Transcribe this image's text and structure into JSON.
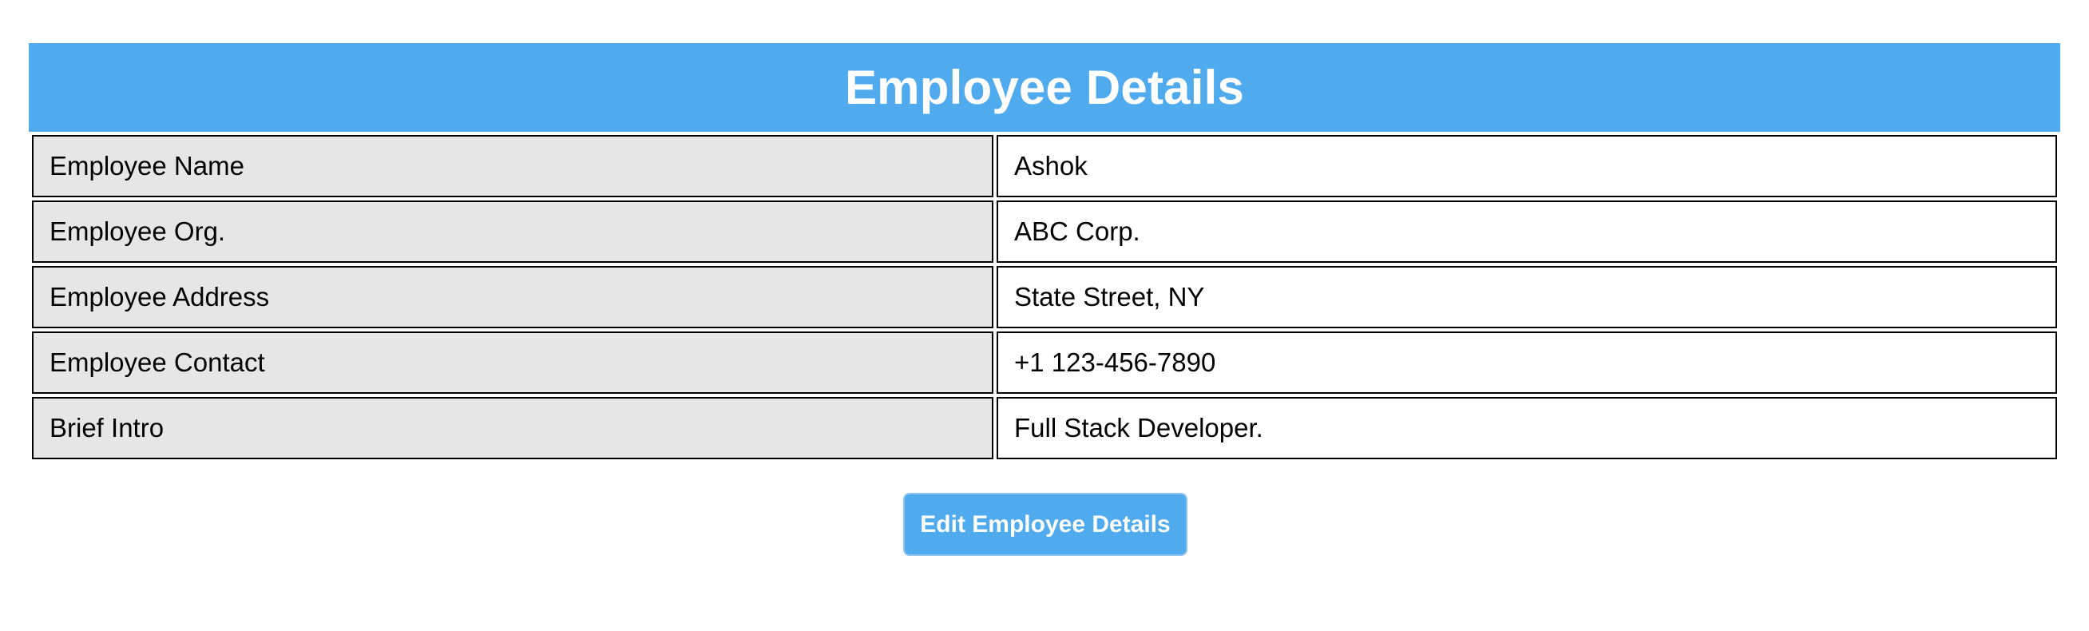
{
  "header": {
    "title": "Employee Details"
  },
  "details": {
    "rows": [
      {
        "label": "Employee Name",
        "value": "Ashok"
      },
      {
        "label": "Employee Org.",
        "value": "ABC Corp."
      },
      {
        "label": "Employee Address",
        "value": "State Street, NY"
      },
      {
        "label": "Employee Contact",
        "value": "+1 123-456-7890"
      },
      {
        "label": "Brief Intro",
        "value": "Full Stack Developer."
      }
    ]
  },
  "actions": {
    "edit_label": "Edit Employee Details"
  },
  "colors": {
    "accent": "#4faaee",
    "label_cell_bg": "#e6e6e6",
    "border": "#000000"
  }
}
